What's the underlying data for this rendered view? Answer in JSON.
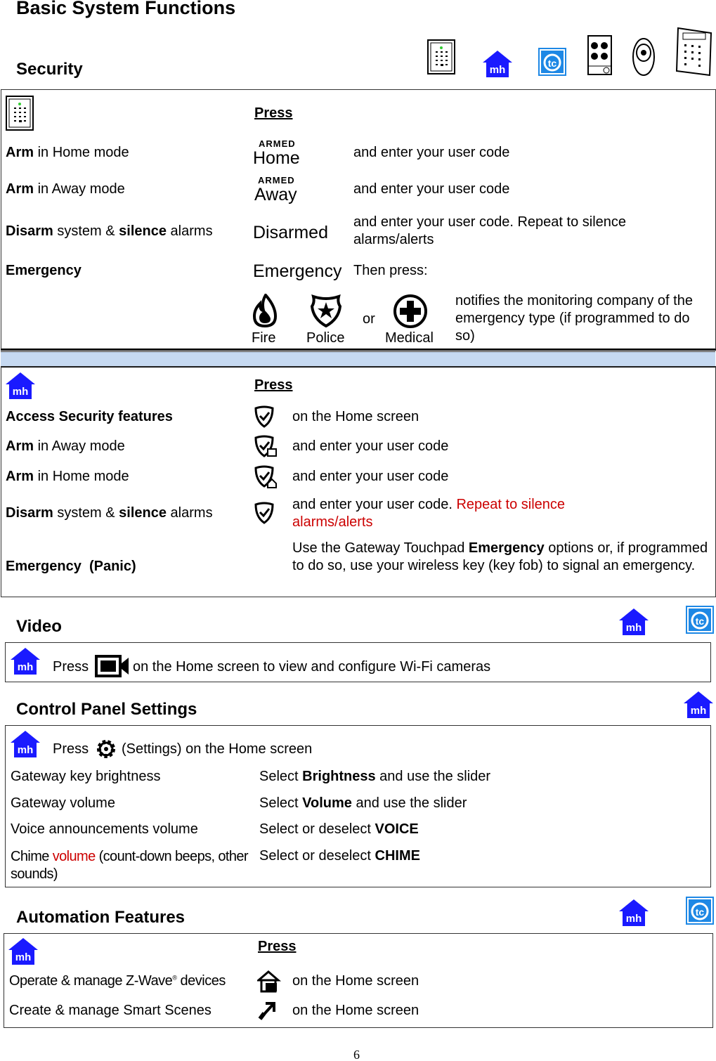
{
  "title": "Basic System Functions",
  "security": {
    "heading": "Security",
    "device_icons": [
      "keypad-icon",
      "mh-icon",
      "tc-icon",
      "keyfob-4button-icon",
      "keyfob-oval-icon",
      "wireless-keypad-icon"
    ],
    "t1": {
      "press": "Press",
      "rows": [
        {
          "bold": "Arm",
          "rest": " in Home mode",
          "key_top": "ARMED",
          "key_main": "Home",
          "desc": "and enter your user code"
        },
        {
          "bold": "Arm",
          "rest": " in Away mode",
          "key_top": "ARMED",
          "key_main": "Away",
          "desc": "and enter your user code"
        },
        {
          "bold": "Disarm",
          "rest": " system & ",
          "bold2": "silence",
          "rest2": " alarms",
          "key_main": "Disarmed",
          "desc": "and enter your user code. Repeat to silence alarms/alerts"
        },
        {
          "bold": "Emergency",
          "key_main": "Emergency",
          "desc": "Then press:"
        }
      ],
      "fire": "Fire",
      "police": "Police",
      "or": "or",
      "medical": "Medical",
      "notify": "notifies the monitoring company of the emergency type (if programmed to do so)"
    },
    "band_color": "#c6d9f1",
    "t2": {
      "press": "Press",
      "r1": {
        "label": "Access Security features",
        "desc": "on the Home screen"
      },
      "r2": {
        "bold": "Arm",
        "rest": " in Away mode",
        "desc": "and enter your user code"
      },
      "r3": {
        "bold": "Arm",
        "rest": " in Home mode",
        "desc": "and enter your user code"
      },
      "r4": {
        "bold": "Disarm",
        "rest": " system & ",
        "bold2": "silence",
        "rest2": " alarms",
        "desc": "and enter your user code. ",
        "desc_red": "Repeat to silence alarms/alerts"
      },
      "r5": {
        "label": "Emergency  (Panic)",
        "d1": "Use the Gateway Touchpad ",
        "d_bold": "Emergency",
        "d2": " options or, if programmed to do so, use your wireless key (key fob) to signal an emergency."
      }
    }
  },
  "video": {
    "heading": "Video",
    "press": "Press",
    "desc": "on the Home screen to view and configure Wi-Fi cameras"
  },
  "control": {
    "heading": "Control Panel Settings",
    "press": "Press",
    "desc": "(Settings) on the Home screen",
    "rows": [
      {
        "label": "Gateway key brightness",
        "pre": "Select ",
        "bold": "Brightness",
        "post": " and use the slider"
      },
      {
        "label": "Gateway volume",
        "pre": "Select ",
        "bold": "Volume",
        "post": " and use the slider"
      },
      {
        "label": "Voice announcements volume",
        "pre": "Select or deselect ",
        "bold": "VOICE",
        "post": ""
      },
      {
        "label": "Chime ",
        "label_red": "volume",
        "label2": " (count-down beeps, other sounds)",
        "pre": "Select or deselect ",
        "bold": "CHIME",
        "post": ""
      }
    ]
  },
  "automation": {
    "heading": "Automation Features",
    "press": "Press",
    "r1": {
      "label": "Operate & manage Z-Wave",
      "sup": "®",
      "label2": " devices",
      "desc": "on the Home screen"
    },
    "r2": {
      "label": "Create & manage Smart Scenes",
      "desc": "on the Home screen"
    }
  },
  "page_number": "6",
  "colors": {
    "mh_blue": "#1a1aff",
    "tc_blue": "#1e88e5",
    "red": "#cc0000"
  }
}
